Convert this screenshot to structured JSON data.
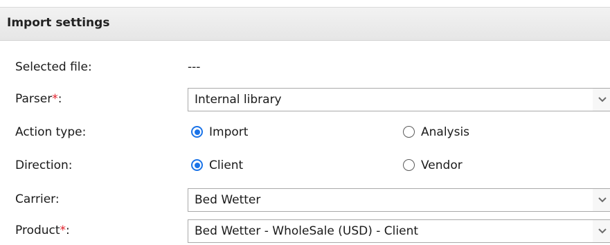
{
  "panel": {
    "title": "Import settings"
  },
  "fields": {
    "selected_file": {
      "label": "Selected file:",
      "value": "---"
    },
    "parser": {
      "label": "Parser",
      "required_mark": "*",
      "colon": ":",
      "value": "Internal library"
    },
    "action_type": {
      "label": "Action type:",
      "options": [
        {
          "label": "Import",
          "checked": true
        },
        {
          "label": "Analysis",
          "checked": false
        }
      ]
    },
    "direction": {
      "label": "Direction:",
      "options": [
        {
          "label": "Client",
          "checked": true
        },
        {
          "label": "Vendor",
          "checked": false
        }
      ]
    },
    "carrier": {
      "label": "Carrier:",
      "value": "Bed Wetter"
    },
    "product": {
      "label": "Product",
      "required_mark": "*",
      "colon": ":",
      "value": "Bed Wetter - WholeSale (USD) - Client"
    }
  },
  "colors": {
    "accent": "#1a73e8",
    "required": "#e0202a"
  },
  "icons": {
    "dropdown": "chevron-down-icon"
  }
}
